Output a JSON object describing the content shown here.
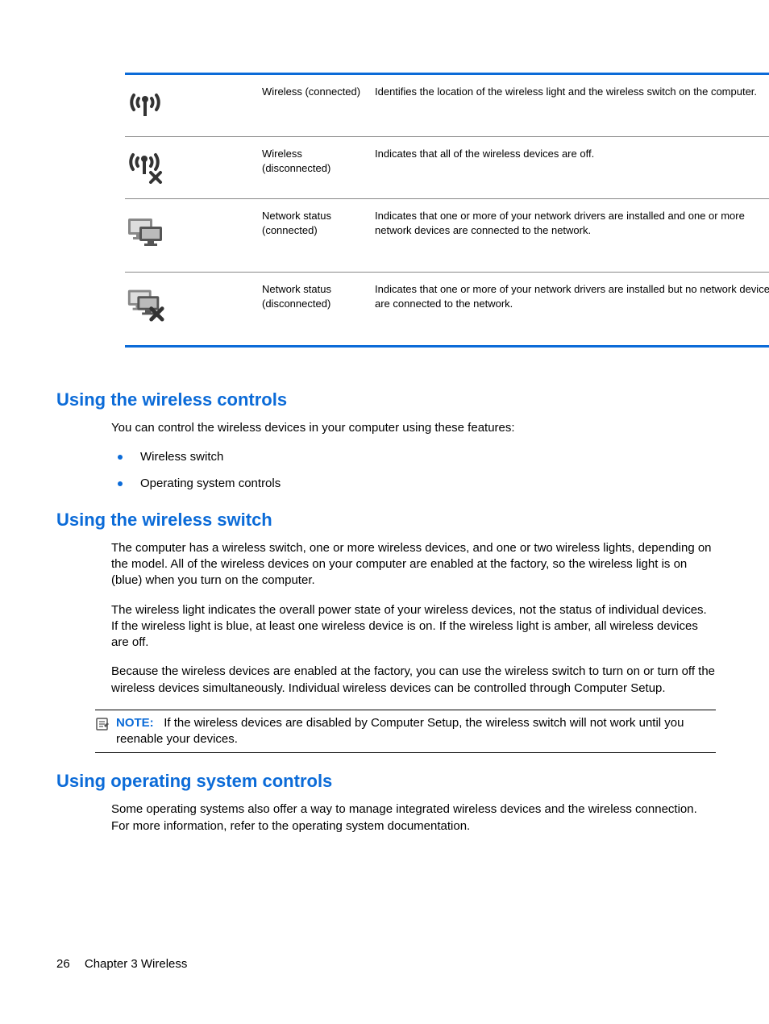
{
  "table": {
    "rows": [
      {
        "label": "Wireless (connected)",
        "desc": "Identifies the location of the wireless light and the wireless switch on the computer."
      },
      {
        "label": "Wireless (disconnected)",
        "desc": "Indicates that all of the wireless devices are off."
      },
      {
        "label": "Network status (connected)",
        "desc": "Indicates that one or more of your network drivers are installed and one or more network devices are connected to the network."
      },
      {
        "label": "Network status (disconnected)",
        "desc": "Indicates that one or more of your network drivers are installed but no network devices are connected to the network."
      }
    ]
  },
  "sections": {
    "s1": {
      "heading": "Using the wireless controls",
      "intro": "You can control the wireless devices in your computer using these features:",
      "bullets": [
        "Wireless switch",
        "Operating system controls"
      ]
    },
    "s2": {
      "heading": "Using the wireless switch",
      "p1": "The computer has a wireless switch, one or more wireless devices, and one or two wireless lights, depending on the model. All of the wireless devices on your computer are enabled at the factory, so the wireless light is on (blue) when you turn on the computer.",
      "p2": "The wireless light indicates the overall power state of your wireless devices, not the status of individual devices. If the wireless light is blue, at least one wireless device is on. If the wireless light is amber, all wireless devices are off.",
      "p3": "Because the wireless devices are enabled at the factory, you can use the wireless switch to turn on or turn off the wireless devices simultaneously. Individual wireless devices can be controlled through Computer Setup."
    },
    "note": {
      "label": "NOTE:",
      "text": "If the wireless devices are disabled by Computer Setup, the wireless switch will not work until you reenable your devices."
    },
    "s3": {
      "heading": "Using operating system controls",
      "p1": "Some operating systems also offer a way to manage integrated wireless devices and the wireless connection. For more information, refer to the operating system documentation."
    }
  },
  "footer": {
    "page": "26",
    "chapter": "Chapter 3   Wireless"
  }
}
